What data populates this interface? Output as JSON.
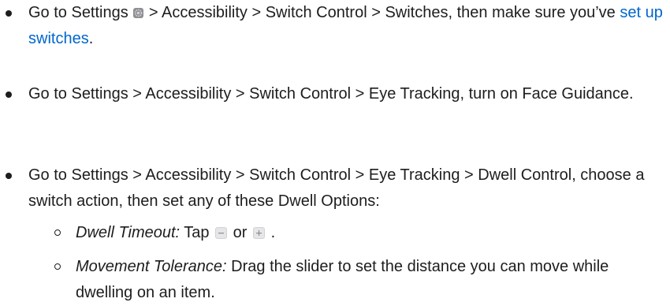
{
  "bullets": [
    {
      "part1": "Go to Settings",
      "icon": "settings-gear-icon",
      "part2": "> Accessibility > Switch Control > Switches, then make sure you’ve",
      "link": "set up switches",
      "part3": "."
    },
    {
      "text": "Go to Settings > Accessibility > Switch Control > Eye Tracking, turn on Face Guidance."
    },
    {
      "text": "Go to Settings > Accessibility > Switch Control > Eye Tracking > Dwell Control, choose a switch action, then set any of these Dwell Options:"
    }
  ],
  "sub_bullets": [
    {
      "term": "Dwell Timeout:",
      "part1": "Tap",
      "minus_icon": "minus-button-icon",
      "part2": "or",
      "plus_icon": "plus-button-icon",
      "part3": "."
    },
    {
      "term": "Movement Tolerance:",
      "text": "Drag the slider to set the distance you can move while dwelling on an item."
    }
  ],
  "colors": {
    "text": "#1d1d1f",
    "link": "#0066cc"
  }
}
